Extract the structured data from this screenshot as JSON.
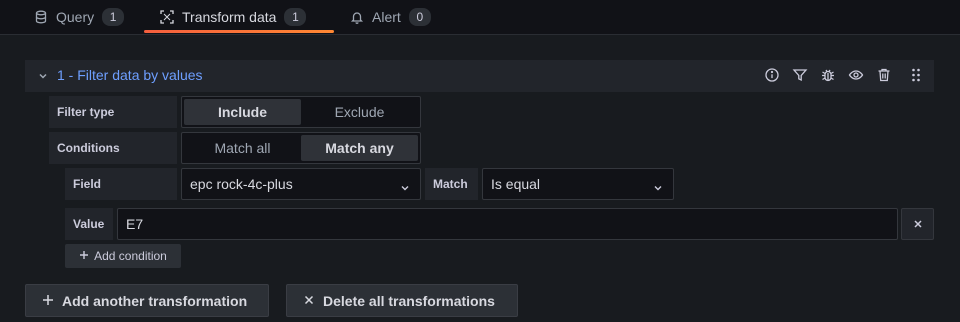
{
  "tabs": [
    {
      "label": "Query",
      "count": "1",
      "icon": "database-icon"
    },
    {
      "label": "Transform data",
      "count": "1",
      "icon": "transform-icon"
    },
    {
      "label": "Alert",
      "count": "0",
      "icon": "bell-icon"
    }
  ],
  "transformation": {
    "title": "1 - Filter data by values",
    "header_icons": [
      "info-icon",
      "filter-icon",
      "bug-icon",
      "eye-icon",
      "trash-icon",
      "drag-handle-icon"
    ]
  },
  "filter_type": {
    "label": "Filter type",
    "options": [
      "Include",
      "Exclude"
    ],
    "selected": "Include"
  },
  "conditions": {
    "label": "Conditions",
    "options": [
      "Match all",
      "Match any"
    ],
    "selected": "Match any"
  },
  "condition": {
    "field_label": "Field",
    "field_value": "epc rock-4c-plus",
    "match_label": "Match",
    "match_value": "Is equal",
    "value_label": "Value",
    "value": "E7"
  },
  "add_condition_label": "Add condition",
  "actions": {
    "add_transformation": "Add another transformation",
    "delete_all": "Delete all transformations"
  },
  "colors": {
    "accent_blue": "#6e9fff",
    "tab_underline": "#f55f3e"
  }
}
